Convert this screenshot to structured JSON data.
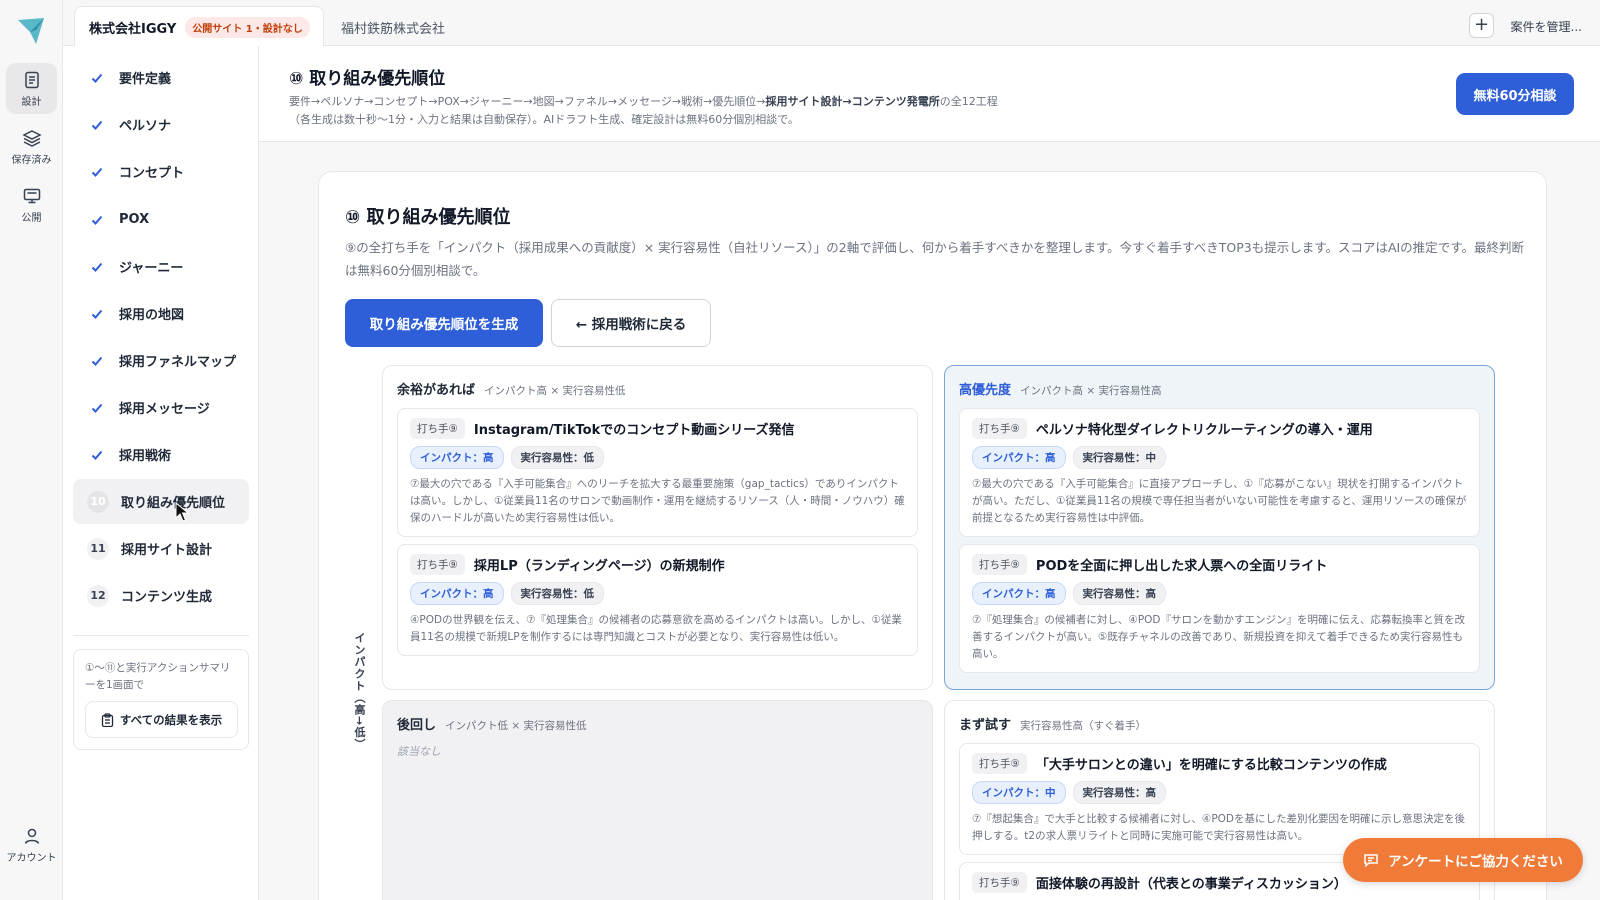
{
  "rail": {
    "items": [
      {
        "label": "設計",
        "icon": "document-icon"
      },
      {
        "label": "保存済み",
        "icon": "layers-icon"
      },
      {
        "label": "公開",
        "icon": "monitor-icon"
      },
      {
        "label": "アカウント",
        "icon": "user-icon"
      }
    ]
  },
  "topbar": {
    "active_tab": "株式会社IGGY",
    "active_badge": "公開サイト 1・設計なし",
    "other_tab": "福村鉄筋株式会社",
    "plus": "+",
    "manage": "案件を管理..."
  },
  "steps": [
    {
      "label": "要件定義",
      "done": true
    },
    {
      "label": "ペルソナ",
      "done": true
    },
    {
      "label": "コンセプト",
      "done": true
    },
    {
      "label": "POX",
      "done": true
    },
    {
      "label": "ジャーニー",
      "done": true
    },
    {
      "label": "採用の地図",
      "done": true
    },
    {
      "label": "採用ファネルマップ",
      "done": true
    },
    {
      "label": "採用メッセージ",
      "done": true
    },
    {
      "label": "採用戦術",
      "done": true
    },
    {
      "label": "取り組み優先順位",
      "num": "10",
      "current": true
    },
    {
      "label": "採用サイト設計",
      "num": "11"
    },
    {
      "label": "コンテンツ生成",
      "num": "12"
    }
  ],
  "summary": {
    "text": "①〜⑪と実行アクションサマリーを1画面で",
    "button": "すべての結果を表示"
  },
  "header": {
    "title": "⑩ 取り組み優先順位",
    "flow_plain": "要件→ペルソナ→コンセプト→POX→ジャーニー→地図→ファネル→メッセージ→戦術→優先順位→",
    "flow_bold": "採用サイト設計→コンテンツ発電所",
    "flow_tail": "の全12工程",
    "note": "（各生成は数十秒〜1分・入力と結果は自動保存）。AIドラフト生成、確定設計は無料60分個別相談で。",
    "cta": "無料60分相談"
  },
  "card": {
    "title": "⑩ 取り組み優先順位",
    "description": "⑨の全打ち手を「インパクト（採用成果への貢献度）× 実行容易性（自社リソース）」の2軸で評価し、何から着手すべきかを整理します。今すぐ着手すべきTOP3も提示します。スコアはAIの推定です。最終判断は無料60分個別相談で。",
    "primary_button": "取り組み優先順位を生成",
    "secondary_button": "← 採用戦術に戻る",
    "axis_label": "インパクト（高→低）"
  },
  "quadrants": {
    "top_left": {
      "title": "余裕があれば",
      "sub": "インパクト高 × 実行容易性低",
      "items": [
        {
          "tag": "打ち手⑨",
          "title": "Instagram/TikTokでのコンセプト動画シリーズ発信",
          "impact": "インパクト：高",
          "ease": "実行容易性：低",
          "body": "⑦最大の穴である『入手可能集合』へのリーチを拡大する最重要施策（gap_tactics）でありインパクトは高い。しかし、①従業員11名のサロンで動画制作・運用を継続するリソース（人・時間・ノウハウ）確保のハードルが高いため実行容易性は低い。"
        },
        {
          "tag": "打ち手⑨",
          "title": "採用LP（ランディングページ）の新規制作",
          "impact": "インパクト：高",
          "ease": "実行容易性：低",
          "body": "④PODの世界観を伝え、⑦『処理集合』の候補者の応募意欲を高めるインパクトは高い。しかし、①従業員11名の規模で新規LPを制作するには専門知識とコストが必要となり、実行容易性は低い。"
        }
      ]
    },
    "top_right": {
      "title": "高優先度",
      "sub": "インパクト高 × 実行容易性高",
      "items": [
        {
          "tag": "打ち手⑨",
          "title": "ペルソナ特化型ダイレクトリクルーティングの導入・運用",
          "impact": "インパクト：高",
          "ease": "実行容易性：中",
          "body": "⑦最大の穴である『入手可能集合』に直接アプローチし、①『応募がこない』現状を打開するインパクトが高い。ただし、①従業員11名の規模で専任担当者がいない可能性を考慮すると、運用リソースの確保が前提となるため実行容易性は中評価。"
        },
        {
          "tag": "打ち手⑨",
          "title": "PODを全面に押し出した求人票への全面リライト",
          "impact": "インパクト：高",
          "ease": "実行容易性：高",
          "body": "⑦『処理集合』の候補者に対し、④POD『サロンを動かすエンジン』を明確に伝え、応募転換率と質を改善するインパクトが高い。⑤既存チャネルの改善であり、新規投資を抑えて着手できるため実行容易性も高い。"
        }
      ]
    },
    "bottom_left": {
      "title": "後回し",
      "sub": "インパクト低 × 実行容易性低",
      "empty": "該当なし"
    },
    "bottom_right": {
      "title": "まず試す",
      "sub": "実行容易性高（すぐ着手）",
      "items": [
        {
          "tag": "打ち手⑨",
          "title": "「大手サロンとの違い」を明確にする比較コンテンツの作成",
          "impact": "インパクト：中",
          "ease": "実行容易性：高",
          "body": "⑦『想起集合』で大手と比較する候補者に対し、④PODを基にした差別化要因を明確に示し意思決定を後押しする。t2の求人票リライトと同時に実施可能で実行容易性は高い。"
        },
        {
          "tag": "打ち手⑨",
          "title": "面接体験の再設計（代表との事業ディスカッション）",
          "impact": "",
          "ease": "",
          "body": ""
        }
      ]
    }
  },
  "survey": {
    "label": "アンケートにご協力ください"
  },
  "colors": {
    "accent": "#2f5fd8",
    "survey": "#f07a38",
    "badge_text": "#c2410c"
  }
}
